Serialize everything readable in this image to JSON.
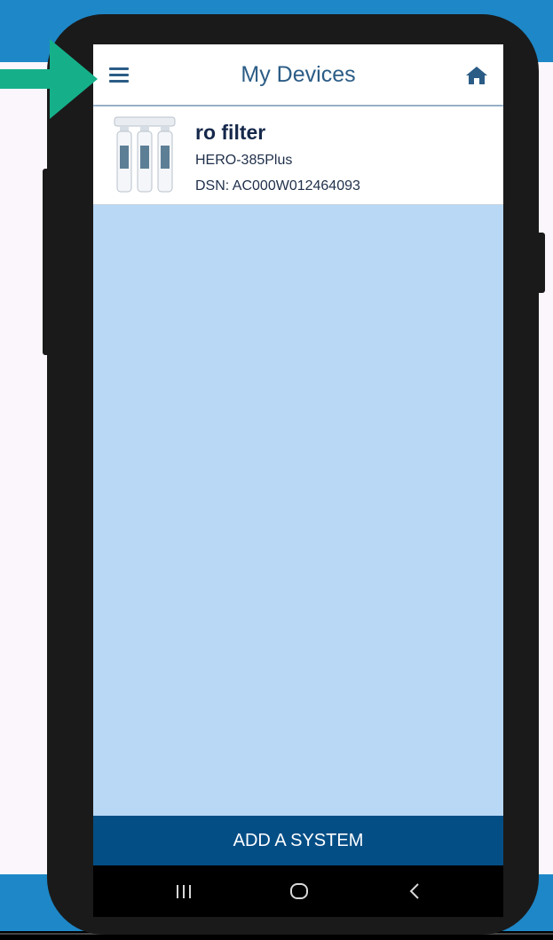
{
  "header": {
    "title": "My Devices",
    "menu_icon": "hamburger-menu-icon",
    "home_icon": "home-icon"
  },
  "devices": [
    {
      "name": "ro filter",
      "model": "HERO-385Plus",
      "dsn": "DSN: AC000W012464093"
    }
  ],
  "add_system": {
    "label": "ADD A SYSTEM"
  },
  "nav_bar": {
    "recents_icon": "recents-icon",
    "home_icon": "home-circle-icon",
    "back_icon": "back-chevron-icon"
  },
  "colors": {
    "brand_blue": "#1e87c7",
    "header_text": "#2b5c86",
    "list_background": "#b8d8f6",
    "button_blue": "#044e86",
    "arrow_green": "#15b08a"
  }
}
